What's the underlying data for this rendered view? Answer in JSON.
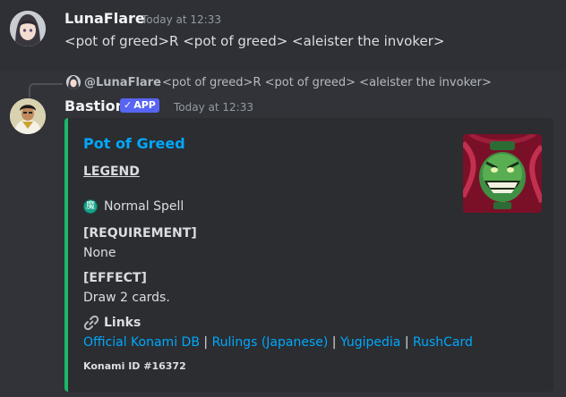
{
  "message1": {
    "username": "LunaFlare",
    "timestamp": "Today at 12:33",
    "content": "<pot of greed>R <pot of greed> <aleister the invoker>"
  },
  "reply": {
    "mention": "@LunaFlare",
    "text": "<pot of greed>R <pot of greed> <aleister the invoker>"
  },
  "message2": {
    "username": "Bastion",
    "badge": "APP",
    "timestamp": "Today at 12:33"
  },
  "embed": {
    "accent_color": "#1cb86a",
    "title": "Pot of Greed",
    "rarity": "LEGEND",
    "card_type_icon": "spell-icon",
    "card_type": "Normal Spell",
    "requirement_label": "[REQUIREMENT]",
    "requirement_value": "None",
    "effect_label": "[EFFECT]",
    "effect_value": "Draw 2 cards.",
    "links_label": "Links",
    "links": [
      "Official Konami DB",
      "Rulings (Japanese)",
      "Yugipedia",
      "RushCard"
    ],
    "separator": "|",
    "konami_id": "Konami ID #16372"
  }
}
